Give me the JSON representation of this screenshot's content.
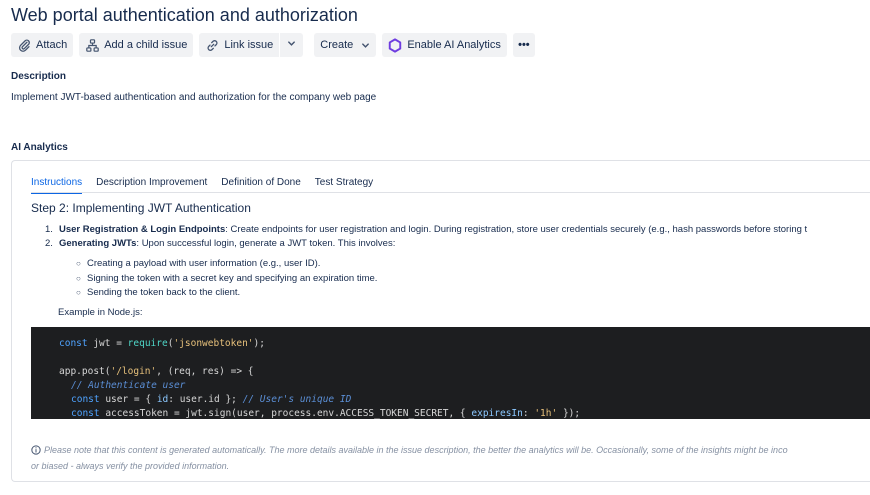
{
  "issue": {
    "title": "Web portal authentication and authorization"
  },
  "toolbar": {
    "attach": "Attach",
    "add_child": "Add a child issue",
    "link_issue": "Link issue",
    "create": "Create",
    "ai_analytics": "Enable AI Analytics",
    "more": "•••"
  },
  "description": {
    "label": "Description",
    "text": "Implement JWT-based authentication and authorization for the company web page"
  },
  "ai": {
    "label": "AI Analytics",
    "tabs": [
      {
        "label": "Instructions",
        "active": true
      },
      {
        "label": "Description Improvement",
        "active": false
      },
      {
        "label": "Definition of Done",
        "active": false
      },
      {
        "label": "Test Strategy",
        "active": false
      }
    ],
    "step_title": "Step 2: Implementing JWT Authentication",
    "ordered": [
      {
        "num": "1.",
        "bold": "User Registration & Login Endpoints",
        "text": ": Create endpoints for user registration and login. During registration, store user credentials securely (e.g., hash passwords before storing t"
      },
      {
        "num": "2.",
        "bold": "Generating JWTs",
        "text": ": Upon successful login, generate a JWT token. This involves:"
      }
    ],
    "bullets": [
      "Creating a payload with user information (e.g., user ID).",
      "Signing the token with a secret key and specifying an expiration time.",
      "Sending the token back to the client."
    ],
    "example_label": "Example in Node.js:",
    "code": {
      "line1": {
        "kw": "const",
        "var": " jwt = ",
        "fn": "require",
        "open": "(",
        "str": "'jsonwebtoken'",
        "close": ");"
      },
      "line2": {
        "pre": "app.post(",
        "str": "'/login'",
        "post": ", (req, res) => {"
      },
      "line3": "// Authenticate user",
      "line4": {
        "kw": "const",
        "pre": " user = { ",
        "prop": "id",
        "post": ": user.id }; ",
        "cm": "// User's unique ID"
      },
      "line5": {
        "kw": "const",
        "pre": " accessToken = jwt.sign(user, process.env.ACCESS_TOKEN_SECRET, { ",
        "prop": "expiresIn",
        "mid": ": ",
        "str": "'1h'",
        "post": " });"
      }
    },
    "note_line1": "Please note that this content is generated automatically. The more details available in the issue description, the better the analytics will be. Occasionally, some of the insights might be inco",
    "note_line2": "or biased - always verify the provided information."
  }
}
